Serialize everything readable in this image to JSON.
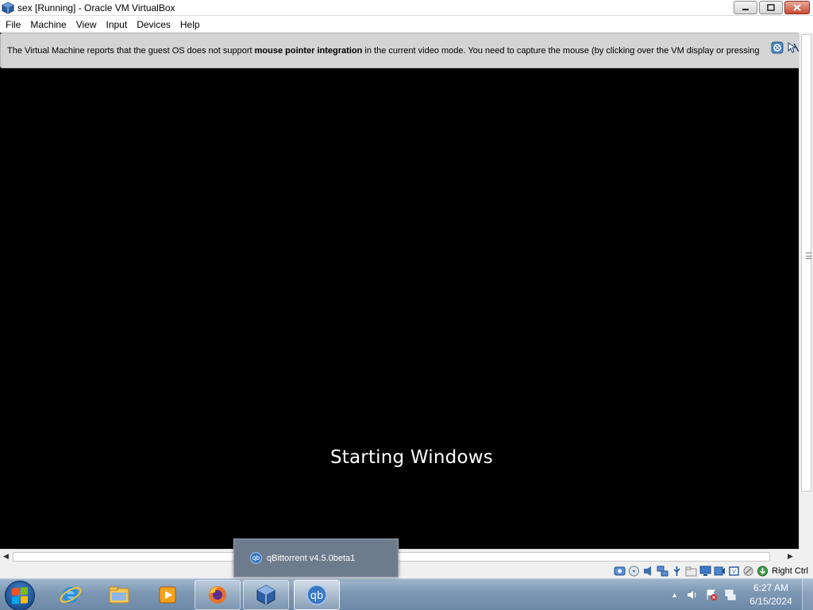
{
  "window": {
    "title": "sex [Running] - Oracle VM VirtualBox",
    "controls": {
      "minimize_icon": "minimize-icon",
      "maximize_icon": "maximize-icon",
      "close_icon": "close-icon"
    }
  },
  "menu": {
    "items": [
      {
        "label": "File"
      },
      {
        "label": "Machine"
      },
      {
        "label": "View"
      },
      {
        "label": "Input"
      },
      {
        "label": "Devices"
      },
      {
        "label": "Help"
      }
    ]
  },
  "notice": {
    "text_before": "The Virtual Machine reports that the guest OS does not support ",
    "text_bold": "mouse pointer integration",
    "text_after": " in the current video mode. You need to capture the mouse (by clicking over the VM display or pressing",
    "icons": [
      "info-icon",
      "mouse-capture-icon"
    ]
  },
  "vm": {
    "boot_message": "Starting Windows",
    "background": "#000000"
  },
  "statusbar": {
    "icons": [
      "hard-disk-icon",
      "optical-drive-icon",
      "audio-icon",
      "network-icon",
      "usb-icon",
      "shared-folders-icon",
      "display-icon",
      "recording-icon",
      "cpu-icon",
      "mouse-integration-icon",
      "host-key-icon"
    ],
    "host_key_label": "Right Ctrl"
  },
  "preview": {
    "label": "qBittorrent v4.5.0beta1",
    "icon_text": "qb"
  },
  "taskbar": {
    "apps": [
      {
        "name": "internet-explorer",
        "state": "pinned"
      },
      {
        "name": "windows-explorer",
        "state": "pinned"
      },
      {
        "name": "windows-media-player",
        "state": "pinned"
      },
      {
        "name": "firefox",
        "state": "running"
      },
      {
        "name": "virtualbox",
        "state": "running"
      },
      {
        "name": "qbittorrent",
        "state": "active",
        "icon_text": "qb"
      }
    ],
    "tray_arrow": "▲",
    "clock_time": "6:27 AM",
    "clock_date": "6/15/2024"
  },
  "colors": {
    "taskbar": "#7c97b3",
    "notice_background": "#d4d4d4",
    "close_button": "#c84a31"
  }
}
